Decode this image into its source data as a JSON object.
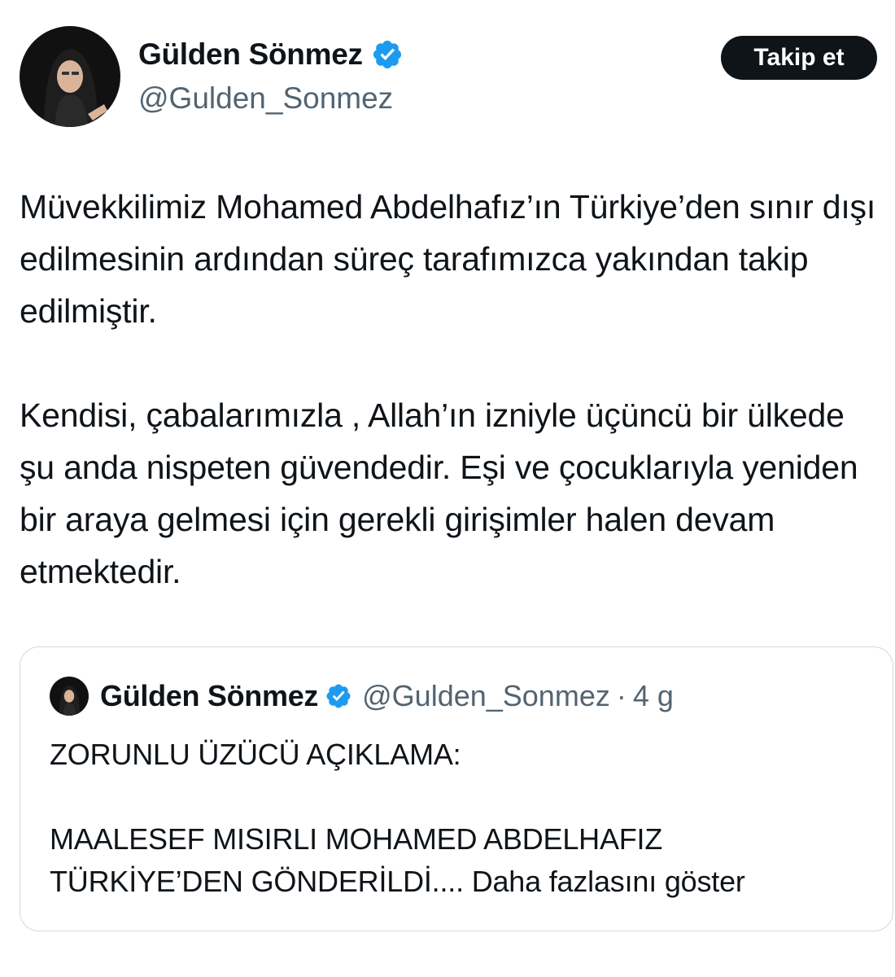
{
  "author": {
    "display_name": "Gülden Sönmez",
    "handle": "@Gulden_Sonmez",
    "verified": true
  },
  "follow_button_label": "Takip et",
  "tweet": {
    "paragraphs": [
      "Müvekkilimiz Mohamed Abdelhafız’ın Türkiye’den sınır dışı edilmesinin ardından süreç tarafımızca yakından takip edilmiştir.",
      "Kendisi, çabalarımızla , Allah’ın izniyle üçüncü bir ülkede şu anda nispeten güvendedir. Eşi ve çocuklarıyla yeniden bir araya gelmesi için gerekli girişimler halen devam etmektedir."
    ]
  },
  "quoted_tweet": {
    "display_name": "Gülden Sönmez",
    "handle": "@Gulden_Sonmez",
    "separator": "·",
    "time": "4 g",
    "line1": "ZORUNLU ÜZÜCÜ AÇIKLAMA:",
    "line2": "MAALESEF MISIRLI MOHAMED ABDELHAFIZ TÜRKİYE’DEN GÖNDERİLDİ....",
    "show_more_label": "Daha fazlasını göster"
  },
  "colors": {
    "text_primary": "#0f1419",
    "text_secondary": "#536471",
    "verified_blue": "#1d9bf0",
    "border": "#cfd9de",
    "button_bg": "#0f1419"
  },
  "icons": [
    "verified-badge-icon",
    "avatar-image"
  ]
}
